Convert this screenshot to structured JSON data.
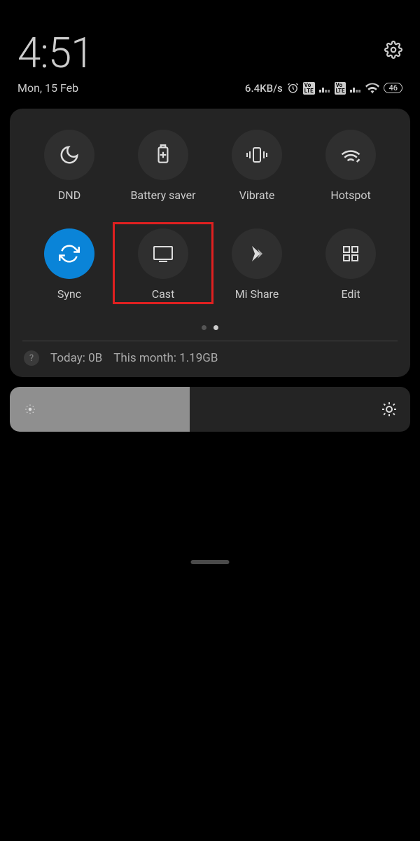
{
  "status": {
    "time": "4:51",
    "date": "Mon, 15 Feb",
    "speed": "6.4KB/s",
    "battery": "46"
  },
  "tiles": [
    {
      "label": "DND",
      "icon": "moon",
      "active": false
    },
    {
      "label": "Battery saver",
      "icon": "battery",
      "active": false
    },
    {
      "label": "Vibrate",
      "icon": "vibrate",
      "active": false
    },
    {
      "label": "Hotspot",
      "icon": "hotspot",
      "active": false
    },
    {
      "label": "Sync",
      "icon": "sync",
      "active": true
    },
    {
      "label": "Cast",
      "icon": "cast",
      "active": false,
      "highlight": true
    },
    {
      "label": "Mi Share",
      "icon": "mishare",
      "active": false
    },
    {
      "label": "Edit",
      "icon": "grid",
      "active": false
    }
  ],
  "usage": {
    "today": "Today: 0B",
    "month": "This month: 1.19GB"
  },
  "brightness_pct": 45
}
